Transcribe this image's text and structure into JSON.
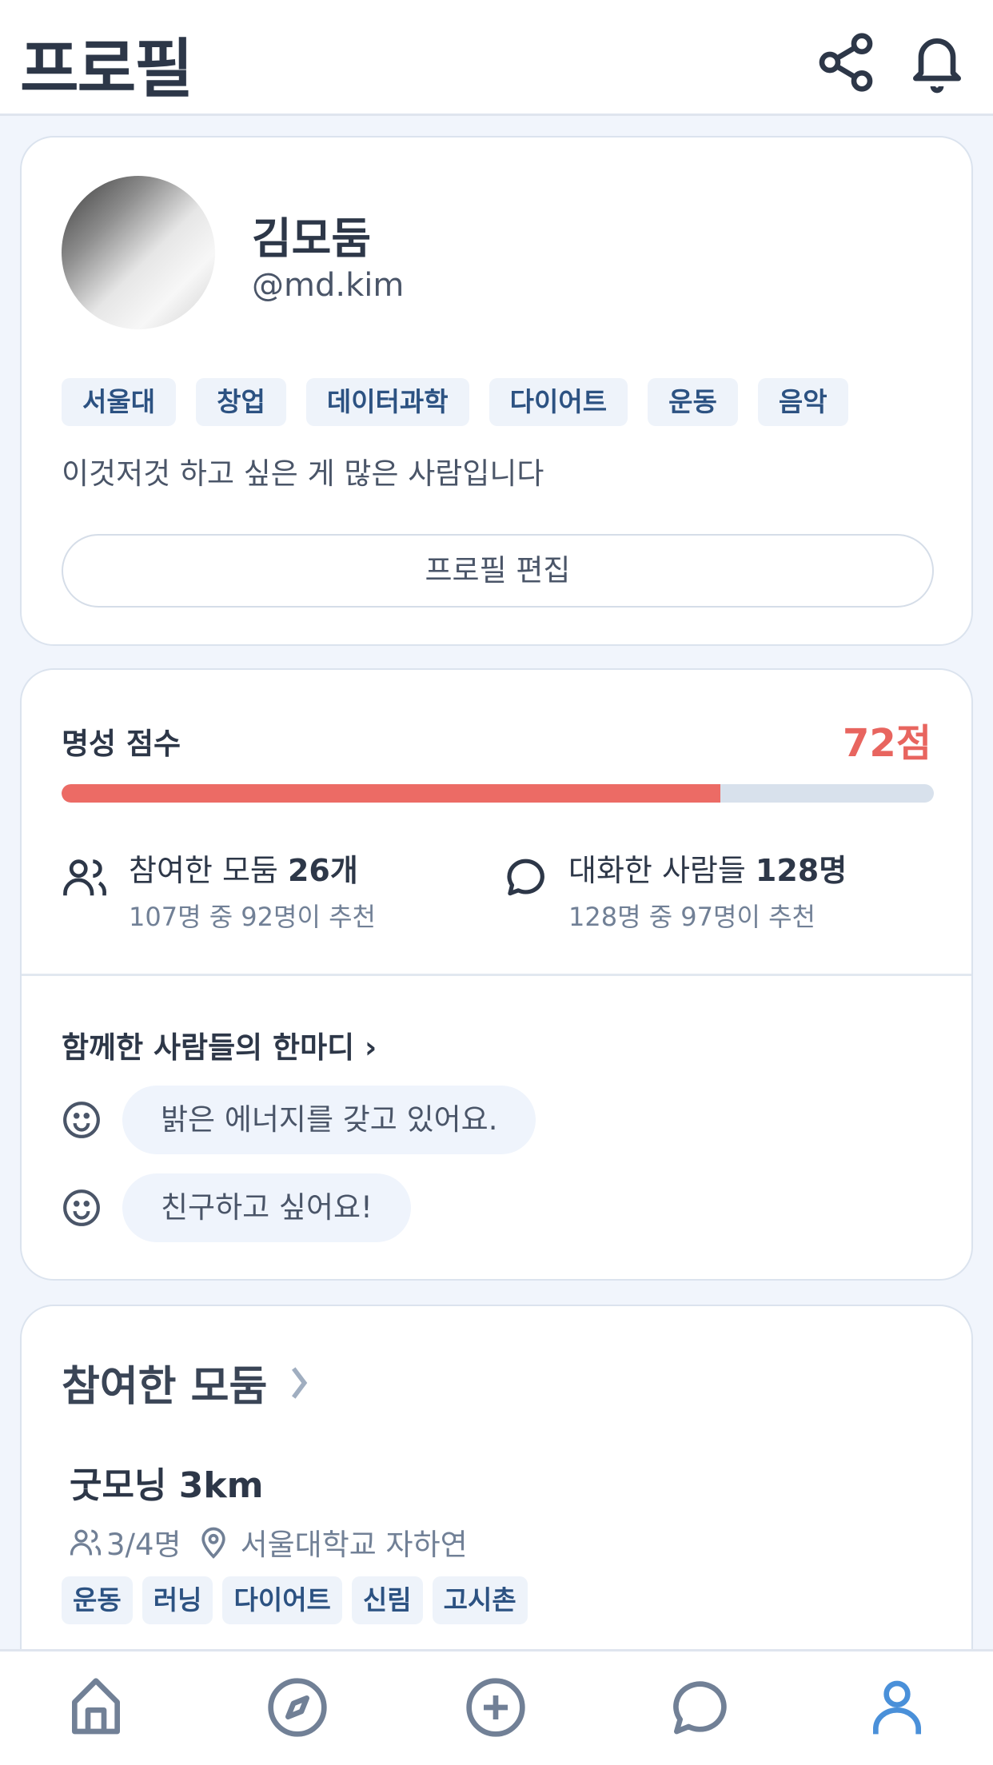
{
  "header": {
    "title": "프로필",
    "icons": [
      "share-icon",
      "bell-icon"
    ]
  },
  "profile": {
    "name": "김모둠",
    "handle": "@md.kim",
    "tags": [
      "서울대",
      "창업",
      "데이터과학",
      "다이어트",
      "운동",
      "음악"
    ],
    "bio": "이것저것 하고 싶은 게 많은 사람입니다",
    "edit_label": "프로필 편집"
  },
  "reputation": {
    "label": "명성 점수",
    "score": "72점",
    "progress_fraction": 0.755,
    "colors": {
      "fill": "#ec6b65",
      "track": "#d8e1ec"
    },
    "stats": [
      {
        "label": "참여한 모둠 ",
        "value": "26개",
        "sub": "107명 중 92명이 추천"
      },
      {
        "label": "대화한 사람들 ",
        "value": "128명",
        "sub": "128명 중 97명이 추천"
      }
    ],
    "comments_title": "함께한 사람들의 한마디 ›",
    "comments": [
      "밝은 에너지를 갖고 있어요.",
      "친구하고 싶어요!"
    ]
  },
  "groups": {
    "title": "참여한 모둠",
    "items": [
      {
        "name": "굿모닝 3km",
        "members": "3/4명",
        "location": "서울대학교 자하연",
        "tags": [
          "운동",
          "러닝",
          "다이어트",
          "신림",
          "고시촌"
        ]
      }
    ]
  },
  "nav": {
    "items": [
      "home",
      "explore",
      "create",
      "chat",
      "profile"
    ],
    "active": "profile",
    "active_color": "#4a90d9"
  }
}
